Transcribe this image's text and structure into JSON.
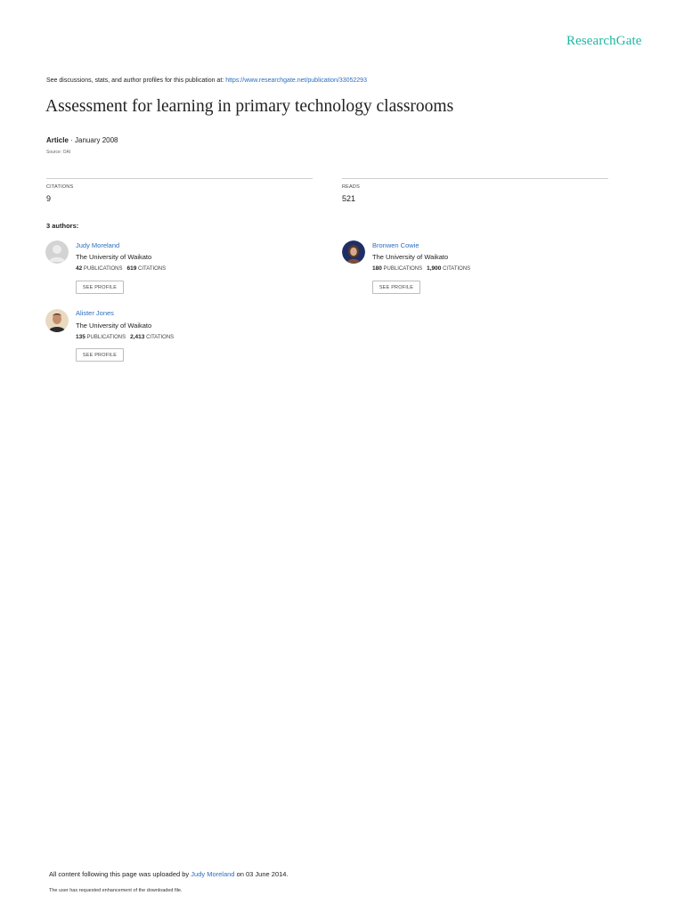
{
  "header": {
    "logo": "ResearchGate"
  },
  "discuss": {
    "text": "See discussions, stats, and author profiles for this publication at:",
    "url": "https://www.researchgate.net/publication/33052293"
  },
  "title": "Assessment for learning in primary technology classrooms",
  "meta": {
    "type": "Article",
    "separator": " · ",
    "date": "January 2008",
    "source": "Source: OAI"
  },
  "stats": {
    "citations_label": "CITATIONS",
    "citations_value": "9",
    "reads_label": "READS",
    "reads_value": "521"
  },
  "authors_heading": "3 authors:",
  "authors": [
    {
      "name": "Judy Moreland",
      "institution": "The University of Waikato",
      "publications": "42",
      "publications_label": "PUBLICATIONS",
      "citations": "619",
      "citations_label": "CITATIONS",
      "button": "SEE PROFILE"
    },
    {
      "name": "Bronwen Cowie",
      "institution": "The University of Waikato",
      "publications": "180",
      "publications_label": "PUBLICATIONS",
      "citations": "1,900",
      "citations_label": "CITATIONS",
      "button": "SEE PROFILE"
    },
    {
      "name": "Alister Jones",
      "institution": "The University of Waikato",
      "publications": "135",
      "publications_label": "PUBLICATIONS",
      "citations": "2,413",
      "citations_label": "CITATIONS",
      "button": "SEE PROFILE"
    }
  ],
  "footer": {
    "prefix": "All content following this page was uploaded by",
    "uploader": "Judy Moreland",
    "suffix": "on 03 June 2014.",
    "note": "The user has requested enhancement of the downloaded file."
  }
}
